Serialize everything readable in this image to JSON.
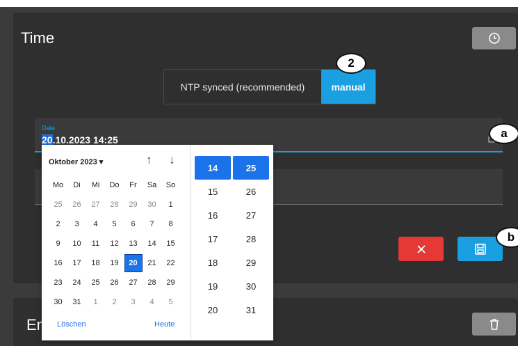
{
  "section_title": "Time",
  "section2_title": "Em",
  "ntp": {
    "synced_label": "NTP synced (recommended)",
    "manual_label": "manual"
  },
  "badges": {
    "two": "2",
    "a": "a",
    "b": "b"
  },
  "date_field": {
    "label": "Date",
    "selected_part": "20",
    "rest": ".10.2023 14:25"
  },
  "picker": {
    "month_label": "Oktober 2023",
    "weekdays": [
      "Mo",
      "Di",
      "Mi",
      "Do",
      "Fr",
      "Sa",
      "So"
    ],
    "weeks": [
      [
        "25",
        "26",
        "27",
        "28",
        "29",
        "30",
        "1"
      ],
      [
        "2",
        "3",
        "4",
        "5",
        "6",
        "7",
        "8"
      ],
      [
        "9",
        "10",
        "11",
        "12",
        "13",
        "14",
        "15"
      ],
      [
        "16",
        "17",
        "18",
        "19",
        "20",
        "21",
        "22"
      ],
      [
        "23",
        "24",
        "25",
        "26",
        "27",
        "28",
        "29"
      ],
      [
        "30",
        "31",
        "1",
        "2",
        "3",
        "4",
        "5"
      ]
    ],
    "selected_day": "20",
    "clear_label": "Löschen",
    "today_label": "Heute",
    "hours": [
      "14",
      "15",
      "16",
      "17",
      "18",
      "19",
      "20"
    ],
    "minutes": [
      "25",
      "26",
      "27",
      "28",
      "29",
      "30",
      "31"
    ]
  },
  "icons": {
    "clock": "clock-icon",
    "cancel": "close-icon",
    "save": "save-icon",
    "delete": "trash-icon"
  },
  "colors": {
    "accent": "#1a9fe0",
    "danger": "#e53935",
    "selected": "#1a73e8"
  }
}
